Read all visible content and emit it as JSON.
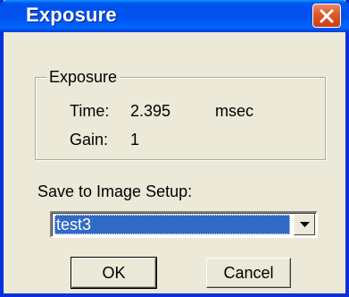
{
  "window": {
    "title": "Exposure",
    "accent_color": "#0055e5",
    "close_icon": "close-icon"
  },
  "group": {
    "legend": "Exposure",
    "time_label": "Time:",
    "time_value": "2.395",
    "time_unit": "msec",
    "gain_label": "Gain:",
    "gain_value": "1"
  },
  "setup": {
    "label": "Save to Image Setup:",
    "selected": "test3",
    "dropdown_icon": "chevron-down-icon"
  },
  "buttons": {
    "ok_label": "OK",
    "cancel_label": "Cancel"
  }
}
